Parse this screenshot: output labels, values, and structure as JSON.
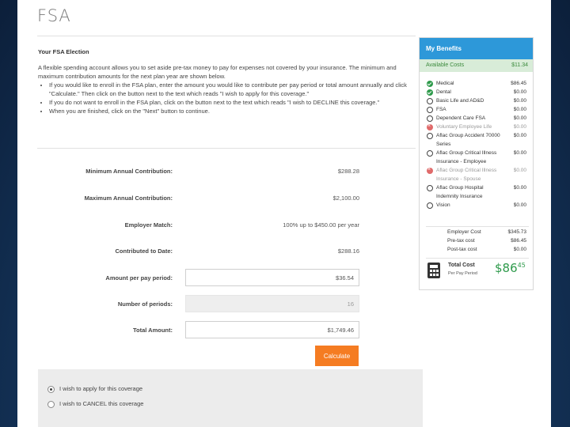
{
  "page": {
    "title": "FSA",
    "section_title": "Your FSA Election",
    "intro": "A flexible spending account allows you to set aside pre-tax money to pay for expenses not covered by your insurance. The minimum and maximum contribution amounts for the next plan year are shown below.",
    "bullets": [
      "If you would like to enroll in the FSA plan, enter the amount you would like to contribute per pay period or total amount annually and click \"Calculate.\" Then click on the button next to the text which reads \"I wish to apply for this coverage.\"",
      "If you do not want to enroll in the FSA plan, click on the button next to the text which reads \"I wish to DECLINE this coverage.\"",
      "When you are finished, click on the \"Next\" button to continue."
    ]
  },
  "form": {
    "min_label": "Minimum Annual Contribution:",
    "min_value": "$288.28",
    "max_label": "Maximum Annual Contribution:",
    "max_value": "$2,100.00",
    "match_label": "Employer Match:",
    "match_value": "100% up to $450.00 per year",
    "contrib_label": "Contributed to Date:",
    "contrib_value": "$288.16",
    "perpay_label": "Amount per pay period:",
    "perpay_value": "$36.54",
    "periods_label": "Number of periods:",
    "periods_value": "16",
    "total_label": "Total Amount:",
    "total_value": "$1,749.46",
    "calculate_label": "Calculate"
  },
  "coverage": {
    "apply_label": "I wish to apply for this coverage",
    "cancel_label": "I wish to CANCEL this coverage",
    "selected": "apply"
  },
  "benefits": {
    "title": "My Benefits",
    "available_label": "Available Costs",
    "available_value": "$11.34",
    "items": [
      {
        "name": "Medical",
        "amount": "$86.45",
        "status": "ok"
      },
      {
        "name": "Dental",
        "amount": "$0.00",
        "status": "ok"
      },
      {
        "name": "Basic Life and AD&D",
        "amount": "$0.00",
        "status": "open"
      },
      {
        "name": "FSA",
        "amount": "$0.00",
        "status": "open"
      },
      {
        "name": "Dependent Care FSA",
        "amount": "$0.00",
        "status": "open"
      },
      {
        "name": "Voluntary Employee Life",
        "amount": "$0.00",
        "status": "no"
      },
      {
        "name": "Aflac Group Accident 70000 Series",
        "amount": "$0.00",
        "status": "open"
      },
      {
        "name": "Aflac Group Critical Illness Insurance - Employee",
        "amount": "$0.00",
        "status": "open"
      },
      {
        "name": "Aflac Group Critical Illness Insurance - Spouse",
        "amount": "$0.00",
        "status": "no"
      },
      {
        "name": "Aflac Group Hospital Indemnity Insurance",
        "amount": "$0.00",
        "status": "open"
      },
      {
        "name": "Vision",
        "amount": "$0.00",
        "status": "open"
      }
    ],
    "employer_cost_label": "Employer Cost",
    "employer_cost_value": "$345.73",
    "pretax_label": "Pre-tax cost",
    "pretax_value": "$86.45",
    "posttax_label": "Post-tax cost",
    "posttax_value": "$0.00",
    "total_label": "Total Cost",
    "total_sub": "Per Pay Period",
    "total_dollars": "$86",
    "total_cents": "45"
  },
  "colors": {
    "accent_blue": "#2d98d9",
    "calculate_orange": "#f57c22",
    "ok_green": "#2e9a4b",
    "decline_red": "#e06a6a"
  }
}
